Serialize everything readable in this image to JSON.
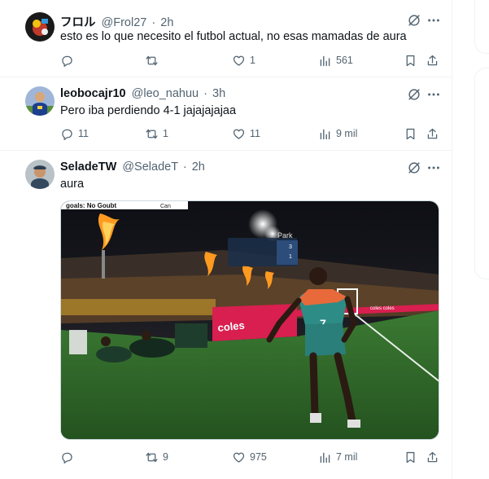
{
  "tweets": [
    {
      "name": "フロル",
      "handle": "@Frol27",
      "time": "2h",
      "text": "esto es lo que necesito el futbol actual, no esas mamadas de aura",
      "replies": "",
      "reposts": "",
      "likes": "1",
      "views": "561"
    },
    {
      "name": "leobocajr10",
      "handle": "@leo_nahuu",
      "time": "3h",
      "text": "Pero iba perdiendo 4-1 jajajajajaa",
      "replies": "11",
      "reposts": "1",
      "likes": "11",
      "views": "9 mil"
    },
    {
      "name": "SeladeTW",
      "handle": "@SeladeT",
      "time": "2h",
      "text": "aura",
      "replies": "",
      "reposts": "9",
      "likes": "975",
      "views": "7 mil",
      "media": {
        "caption_top": "goals: No Goubt",
        "tag": "Can",
        "scoreboard_name": "Park",
        "score_a": "3",
        "score_b": "1",
        "shirt_number": "7",
        "board_text": "coles",
        "board_text_2": "coles coles"
      }
    }
  ],
  "icons": {
    "grok": "grok-icon",
    "more": "more-icon",
    "reply": "reply-icon",
    "repost": "repost-icon",
    "like": "heart-icon",
    "views": "views-icon",
    "bookmark": "bookmark-icon",
    "share": "share-icon"
  },
  "colors": {
    "text": "#0f1419",
    "secondary": "#536471",
    "border": "#eff3f4",
    "pitch": "#2f6a2a",
    "board": "#d81f4f",
    "flame": "#ff9a20"
  }
}
